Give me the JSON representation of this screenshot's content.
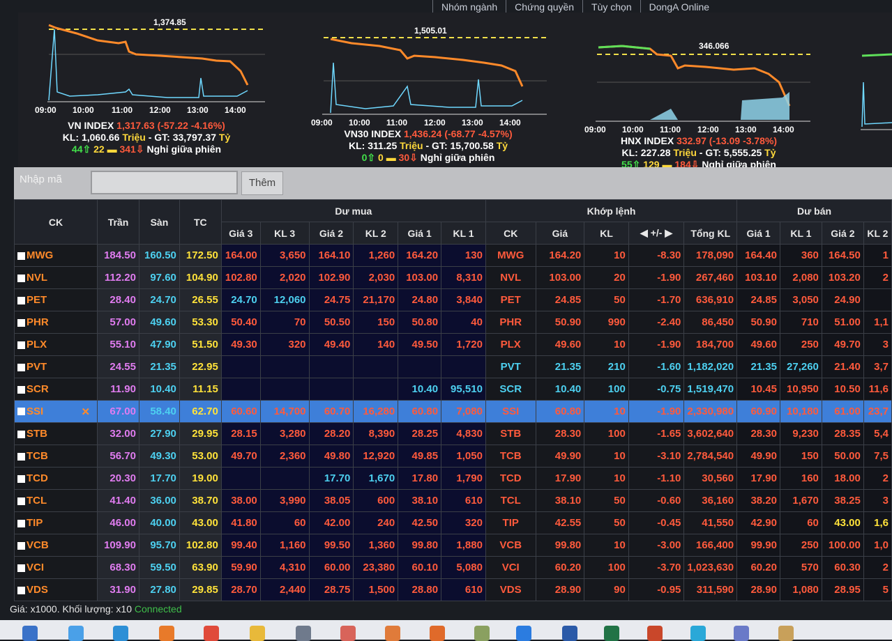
{
  "nav": [
    "Nhóm ngành",
    "Chứng quyền",
    "Tùy chọn",
    "DongA Online"
  ],
  "charts": [
    {
      "peak": "1,374.85",
      "times": [
        "09:00",
        "10:00",
        "11:00",
        "12:00",
        "13:00",
        "14:00"
      ],
      "name": "VN INDEX",
      "value": "1,317.63",
      "change": "(-57.22 -4.16%)",
      "kl_label": "KL:",
      "kl": "1,060.66",
      "unit1": "Triệu",
      "gt_label": "- GT:",
      "gt": "33,797.37",
      "unit2": "Tỷ",
      "up": "44",
      "ref": "22",
      "down": "341",
      "session": "Nghỉ giữa phiên"
    },
    {
      "peak": "1,505.01",
      "times": [
        "09:00",
        "10:00",
        "11:00",
        "12:00",
        "13:00",
        "14:00"
      ],
      "name": "VN30 INDEX",
      "value": "1,436.24",
      "change": "(-68.77 -4.57%)",
      "kl_label": "KL:",
      "kl": "311.25",
      "unit1": "Triệu",
      "gt_label": "- GT:",
      "gt": "15,700.58",
      "unit2": "Tỷ",
      "up": "0",
      "ref": "0",
      "down": "30",
      "session": "Nghỉ giữa phiên"
    },
    {
      "peak": "346.066",
      "times": [
        "09:00",
        "10:00",
        "11:00",
        "12:00",
        "13:00",
        "14:00"
      ],
      "name": "HNX INDEX",
      "value": "332.97",
      "change": "(-13.09 -3.78%)",
      "kl_label": "KL:",
      "kl": "227.28",
      "unit1": "Triệu",
      "gt_label": "- GT:",
      "gt": "5,555.25",
      "unit2": "Tỷ",
      "up": "55",
      "ref": "129",
      "down": "184",
      "session": "Nghỉ giữa phiên"
    }
  ],
  "input": {
    "label": "Nhập mã",
    "value": "",
    "button": "Thêm"
  },
  "headers": {
    "ck": "CK",
    "tran": "Trần",
    "san": "Sàn",
    "tc": "TC",
    "du_mua": "Dư mua",
    "khop": "Khớp lệnh",
    "du_ban": "Dư bán",
    "buy": [
      "Giá 3",
      "KL 3",
      "Giá 2",
      "KL 2",
      "Giá 1",
      "KL 1"
    ],
    "match": [
      "CK",
      "Giá",
      "KL",
      "+/-",
      "Tổng KL"
    ],
    "sell": [
      "Giá 1",
      "KL 1",
      "Giá 2",
      "KL 2"
    ]
  },
  "rows": [
    [
      "MWG",
      "184.50",
      "160.50",
      "172.50",
      "164.00",
      "3,650",
      "164.10",
      "1,260",
      "164.20",
      "130",
      "MWG",
      "164.20",
      "10",
      "-8.30",
      "178,090",
      "164.40",
      "360",
      "164.50",
      "1"
    ],
    [
      "NVL",
      "112.20",
      "97.60",
      "104.90",
      "102.80",
      "2,020",
      "102.90",
      "2,030",
      "103.00",
      "8,310",
      "NVL",
      "103.00",
      "20",
      "-1.90",
      "267,460",
      "103.10",
      "2,080",
      "103.20",
      "2"
    ],
    [
      "PET",
      "28.40",
      "24.70",
      "26.55",
      "24.70",
      "12,060",
      "24.75",
      "21,170",
      "24.80",
      "3,840",
      "PET",
      "24.85",
      "50",
      "-1.70",
      "636,910",
      "24.85",
      "3,050",
      "24.90",
      ""
    ],
    [
      "PHR",
      "57.00",
      "49.60",
      "53.30",
      "50.40",
      "70",
      "50.50",
      "150",
      "50.80",
      "40",
      "PHR",
      "50.90",
      "990",
      "-2.40",
      "86,450",
      "50.90",
      "710",
      "51.00",
      "1,1"
    ],
    [
      "PLX",
      "55.10",
      "47.90",
      "51.50",
      "49.30",
      "320",
      "49.40",
      "140",
      "49.50",
      "1,720",
      "PLX",
      "49.60",
      "10",
      "-1.90",
      "184,700",
      "49.60",
      "250",
      "49.70",
      "3"
    ],
    [
      "PVT",
      "24.55",
      "21.35",
      "22.95",
      "",
      "",
      "",
      "",
      "",
      "",
      "PVT",
      "21.35",
      "210",
      "-1.60",
      "1,182,020",
      "21.35",
      "27,260",
      "21.40",
      "3,7"
    ],
    [
      "SCR",
      "11.90",
      "10.40",
      "11.15",
      "",
      "",
      "",
      "",
      "10.40",
      "95,510",
      "SCR",
      "10.40",
      "100",
      "-0.75",
      "1,519,470",
      "10.45",
      "10,950",
      "10.50",
      "11,6"
    ],
    [
      "SSI",
      "67.00",
      "58.40",
      "62.70",
      "60.60",
      "14,700",
      "60.70",
      "16,280",
      "60.80",
      "7,080",
      "SSI",
      "60.80",
      "10",
      "-1.90",
      "2,330,980",
      "60.90",
      "10,180",
      "61.00",
      "23,7"
    ],
    [
      "STB",
      "32.00",
      "27.90",
      "29.95",
      "28.15",
      "3,280",
      "28.20",
      "8,390",
      "28.25",
      "4,830",
      "STB",
      "28.30",
      "100",
      "-1.65",
      "3,602,640",
      "28.30",
      "9,230",
      "28.35",
      "5,4"
    ],
    [
      "TCB",
      "56.70",
      "49.30",
      "53.00",
      "49.70",
      "2,360",
      "49.80",
      "12,920",
      "49.85",
      "1,050",
      "TCB",
      "49.90",
      "10",
      "-3.10",
      "2,784,540",
      "49.90",
      "150",
      "50.00",
      "7,5"
    ],
    [
      "TCD",
      "20.30",
      "17.70",
      "19.00",
      "",
      "",
      "17.70",
      "1,670",
      "17.80",
      "1,790",
      "TCD",
      "17.90",
      "10",
      "-1.10",
      "30,560",
      "17.90",
      "160",
      "18.00",
      "2"
    ],
    [
      "TCL",
      "41.40",
      "36.00",
      "38.70",
      "38.00",
      "3,990",
      "38.05",
      "600",
      "38.10",
      "610",
      "TCL",
      "38.10",
      "50",
      "-0.60",
      "36,160",
      "38.20",
      "1,670",
      "38.25",
      "3"
    ],
    [
      "TIP",
      "46.00",
      "40.00",
      "43.00",
      "41.80",
      "60",
      "42.00",
      "240",
      "42.50",
      "320",
      "TIP",
      "42.55",
      "50",
      "-0.45",
      "41,550",
      "42.90",
      "60",
      "43.00",
      "1,6"
    ],
    [
      "VCB",
      "109.90",
      "95.70",
      "102.80",
      "99.40",
      "1,160",
      "99.50",
      "1,360",
      "99.80",
      "1,880",
      "VCB",
      "99.80",
      "10",
      "-3.00",
      "166,400",
      "99.90",
      "250",
      "100.00",
      "1,0"
    ],
    [
      "VCI",
      "68.30",
      "59.50",
      "63.90",
      "59.90",
      "4,310",
      "60.00",
      "23,380",
      "60.10",
      "5,080",
      "VCI",
      "60.20",
      "100",
      "-3.70",
      "1,023,630",
      "60.20",
      "570",
      "60.30",
      "2"
    ],
    [
      "VDS",
      "31.90",
      "27.80",
      "29.85",
      "28.70",
      "2,440",
      "28.75",
      "1,500",
      "28.80",
      "610",
      "VDS",
      "28.90",
      "90",
      "-0.95",
      "311,590",
      "28.90",
      "1,080",
      "28.95",
      "5"
    ]
  ],
  "status": {
    "note": "Giá: x1000. Khối lượng: x10",
    "conn": "Connected"
  },
  "colors": {
    "ceil": "#e07cf0",
    "floor": "#4dd0f0",
    "ref": "#ffe23a",
    "down": "#ff8a2a",
    "selected": "#3e7fd9"
  }
}
